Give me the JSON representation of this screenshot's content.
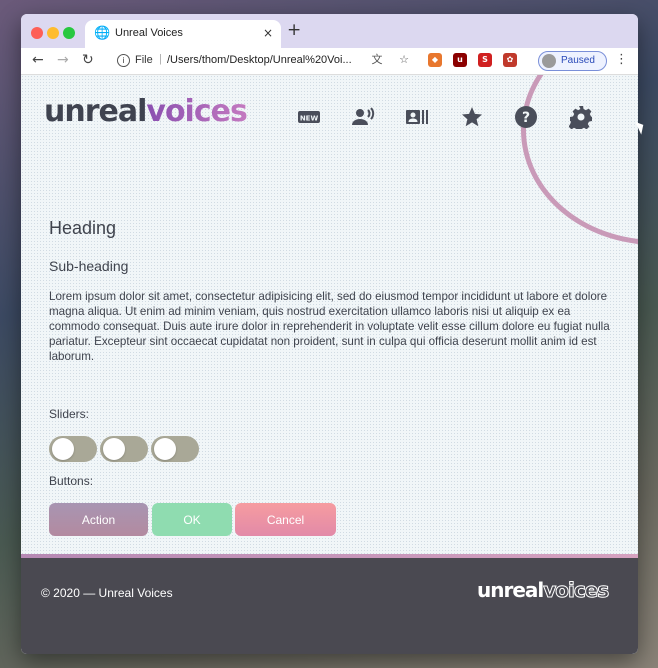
{
  "browser": {
    "tab_title": "Unreal Voices",
    "tab_close": "×",
    "new_tab": "+",
    "omnibox_scheme": "File",
    "omnibox_url": "/Users/thom/Desktop/Unreal%20Voi...",
    "profile_status": "Paused"
  },
  "header": {
    "logo_part1": "unreal",
    "logo_part2": "voices",
    "nav_icons": [
      "new-icon",
      "voice-icon",
      "id-card-icon",
      "star-icon",
      "help-icon",
      "gear-icon"
    ]
  },
  "content": {
    "heading": "Heading",
    "subheading": "Sub-heading",
    "paragraph": "Lorem ipsum dolor sit amet, consectetur adipisicing elit, sed do eiusmod tempor incididunt ut labore et dolore magna aliqua. Ut enim ad minim veniam, quis nostrud exercitation ullamco laboris nisi ut aliquip ex ea commodo consequat. Duis aute irure dolor in reprehenderit in voluptate velit esse cillum dolore eu fugiat nulla pariatur. Excepteur sint occaecat cupidatat non proident, sunt in culpa qui officia deserunt mollit anim id est laborum.",
    "sliders_label": "Sliders:",
    "buttons_label": "Buttons:",
    "buttons": {
      "action": "Action",
      "ok": "OK",
      "cancel": "Cancel"
    }
  },
  "footer": {
    "copyright": "© 2020 — Unreal Voices",
    "logo_part1": "unreal",
    "logo_part2": "voices"
  },
  "colors": {
    "accent_purple": "#8a4fb0",
    "ok_green": "#8fdcb0",
    "cancel_pink": "#f69ca0",
    "footer_bg": "#4a4951"
  }
}
